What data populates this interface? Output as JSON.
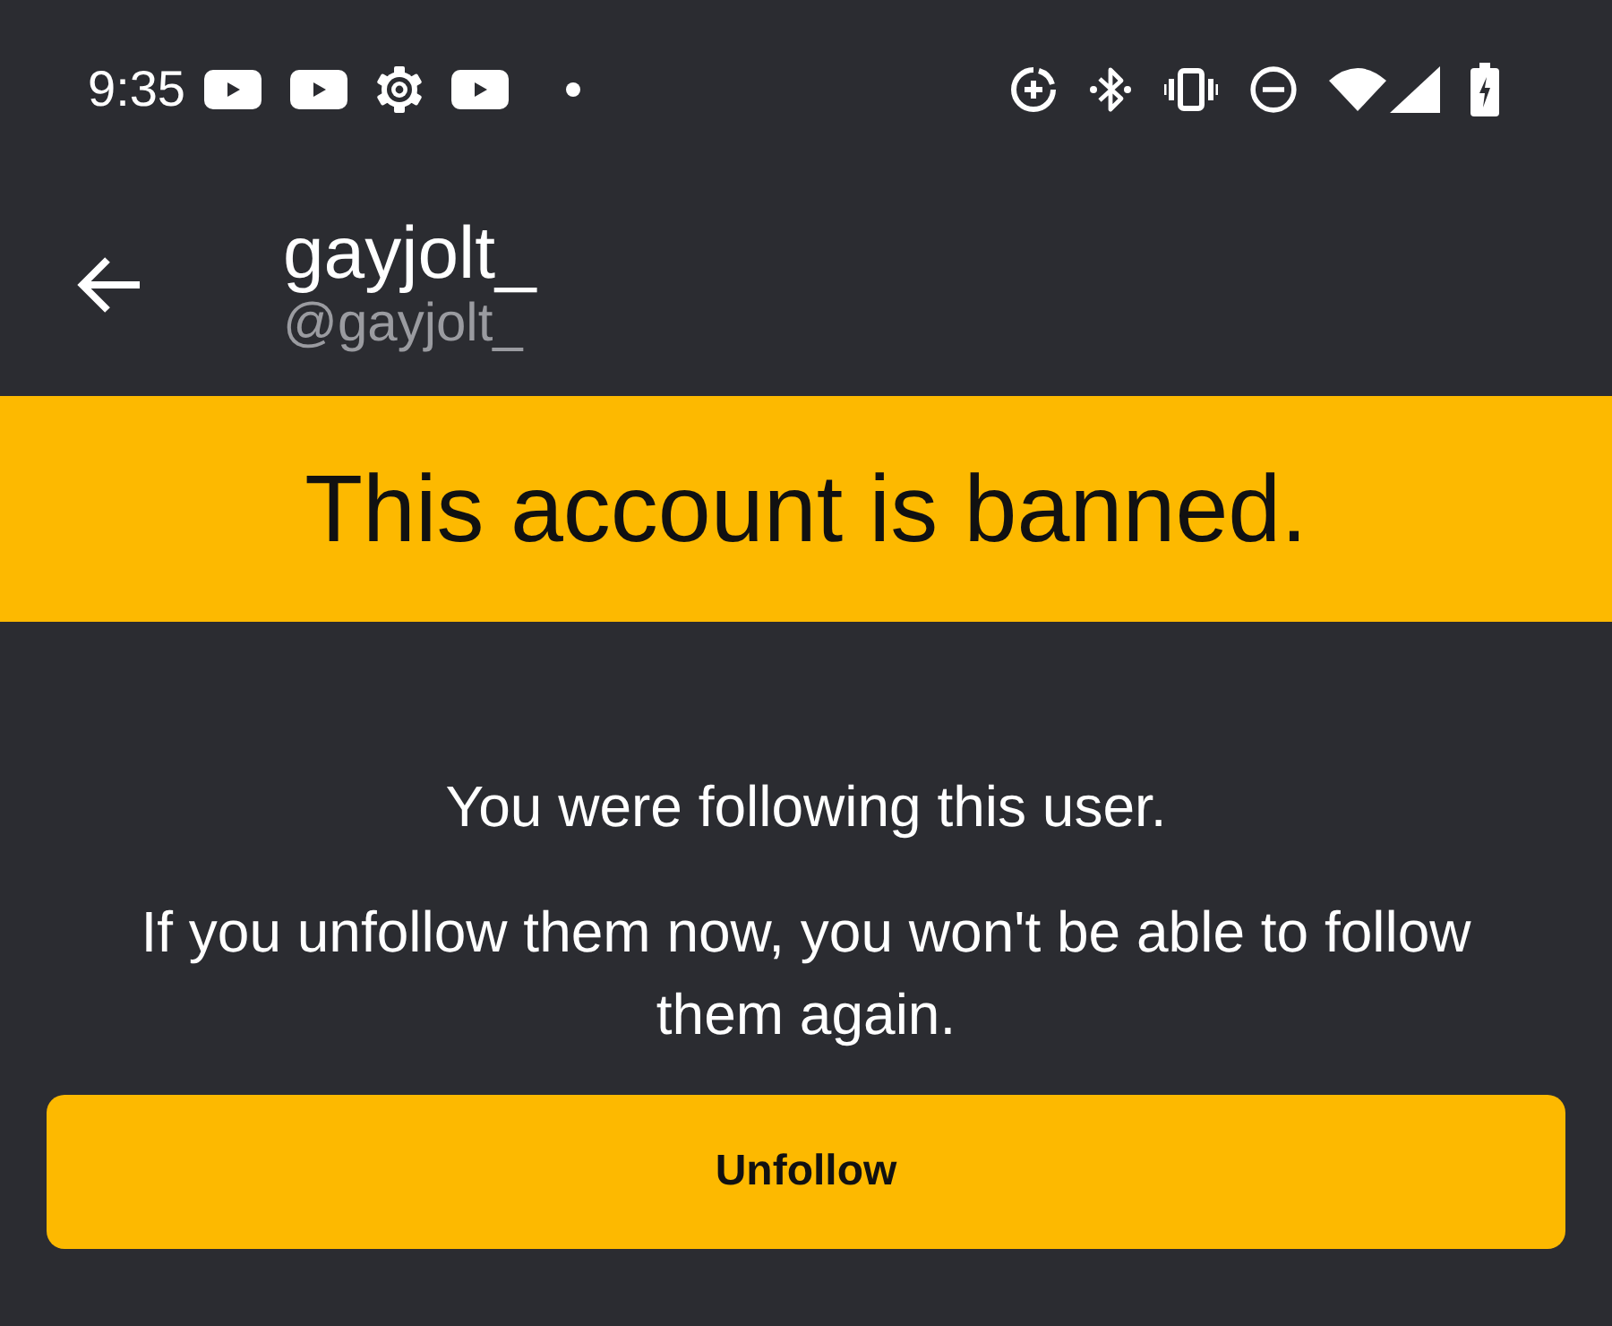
{
  "status_bar": {
    "time": "9:35"
  },
  "header": {
    "title": "gayjolt_",
    "handle": "@gayjolt_"
  },
  "banner": {
    "text": "This account is banned."
  },
  "message": {
    "lines": [
      "You were following this user.",
      "If you unfollow them now, you won't be able to follow them again."
    ]
  },
  "button": {
    "label": "Unfollow"
  }
}
